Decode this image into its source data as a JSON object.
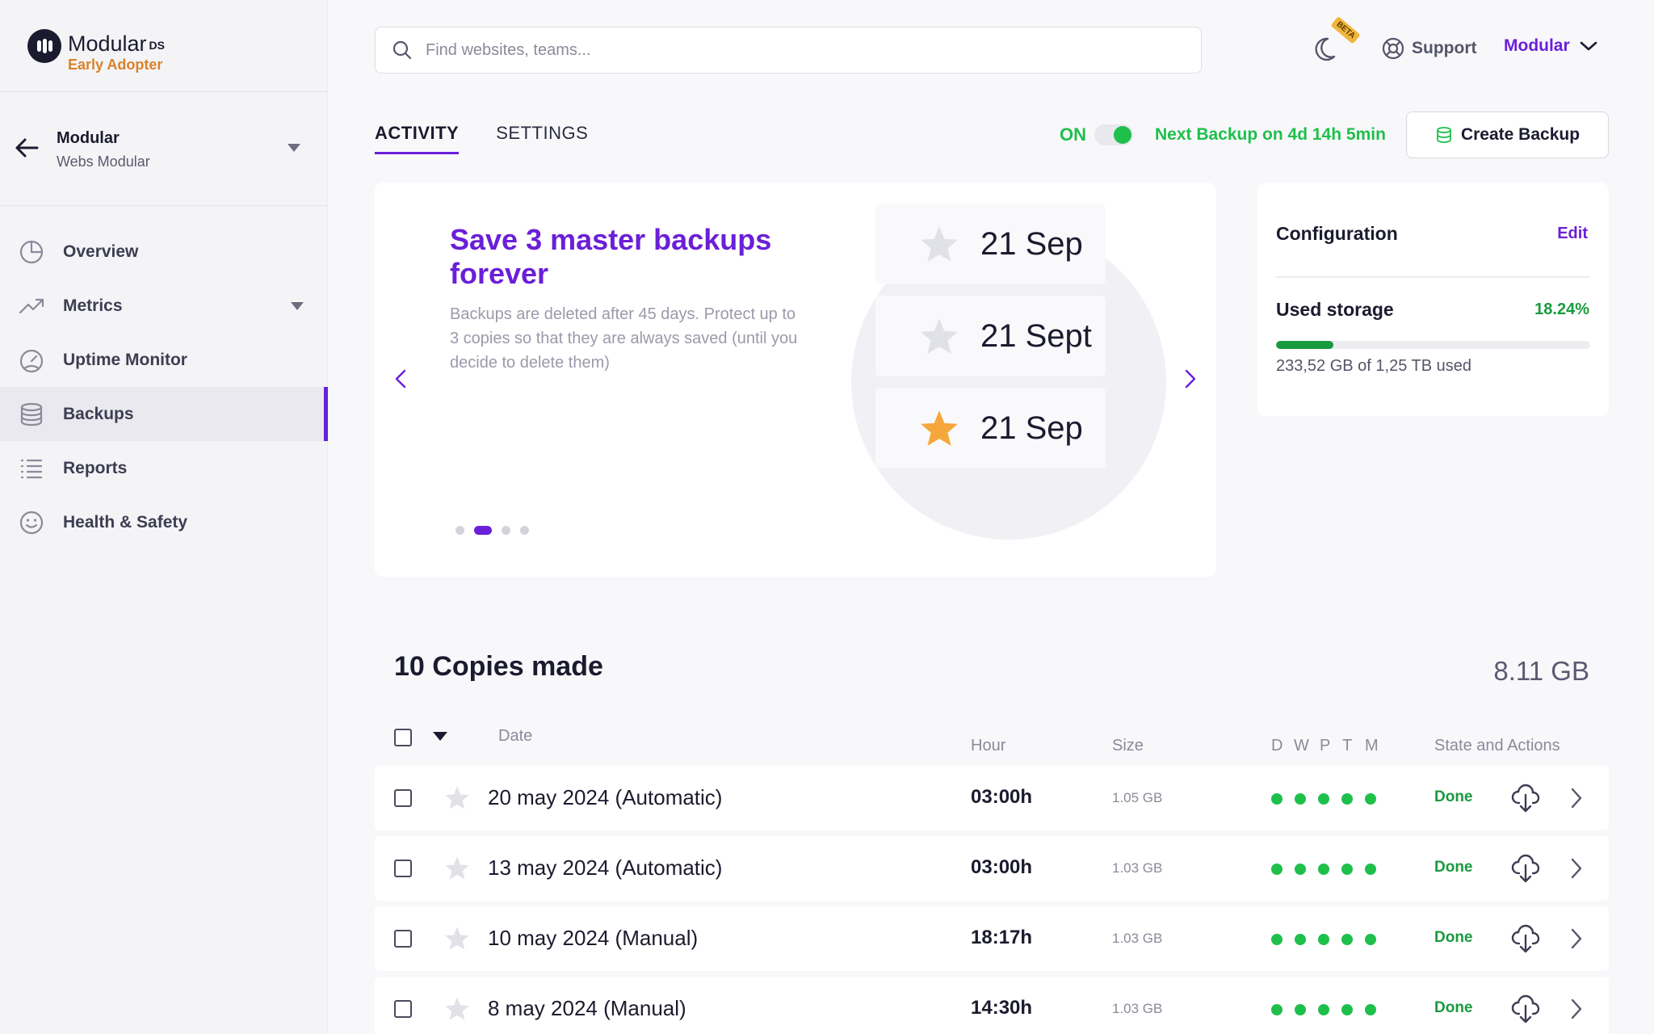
{
  "brand": {
    "name": "Modular",
    "suffix": "DS",
    "subtitle": "Early Adopter"
  },
  "site": {
    "name": "Modular",
    "subtitle": "Webs Modular"
  },
  "nav": [
    {
      "label": "Overview",
      "icon": "pie-chart-icon"
    },
    {
      "label": "Metrics",
      "icon": "trend-icon"
    },
    {
      "label": "Uptime Monitor",
      "icon": "gauge-icon"
    },
    {
      "label": "Backups",
      "icon": "database-icon",
      "active": true
    },
    {
      "label": "Reports",
      "icon": "list-icon"
    },
    {
      "label": "Health & Safety",
      "icon": "smile-icon"
    }
  ],
  "search": {
    "placeholder": "Find websites, teams..."
  },
  "topbar": {
    "beta": "BETA",
    "support": "Support",
    "account": "Modular"
  },
  "tabs": {
    "activity": "ACTIVITY",
    "settings": "SETTINGS"
  },
  "backup_toggle": {
    "label": "ON",
    "next": "Next Backup on 4d 14h 5min"
  },
  "create_backup": "Create Backup",
  "promo": {
    "title": "Save 3 master backups forever",
    "text": "Backups are deleted after 45 days. Protect up to 3 copies so that they are always saved (until you decide to delete them)",
    "dates": [
      "21 Sep",
      "21 Sept",
      "21 Sep"
    ],
    "active_slide": 2,
    "slides": 4
  },
  "config": {
    "title": "Configuration",
    "edit": "Edit",
    "storage_title": "Used storage",
    "storage_pct": "18.24%",
    "storage_fraction": 0.1824,
    "storage_text": "233,52 GB of 1,25 TB used"
  },
  "copies": {
    "title": "10 Copies made",
    "total_size": "8.11 GB",
    "columns": {
      "date": "Date",
      "hour": "Hour",
      "size": "Size",
      "flags": [
        "D",
        "W",
        "P",
        "T",
        "M"
      ],
      "state": "State and Actions"
    },
    "rows": [
      {
        "date": "20 may 2024 (Automatic)",
        "hour": "03:00h",
        "size": "1.05 GB",
        "state": "Done"
      },
      {
        "date": "13 may 2024 (Automatic)",
        "hour": "03:00h",
        "size": "1.03 GB",
        "state": "Done"
      },
      {
        "date": "10 may 2024 (Manual)",
        "hour": "18:17h",
        "size": "1.03 GB",
        "state": "Done"
      },
      {
        "date": "8 may 2024 (Manual)",
        "hour": "14:30h",
        "size": "1.03 GB",
        "state": "Done"
      }
    ]
  },
  "colors": {
    "accent": "#6a1fd8",
    "success": "#1fbf4b",
    "star_active": "#f5a73b",
    "star_inactive": "#e1e1e8"
  }
}
